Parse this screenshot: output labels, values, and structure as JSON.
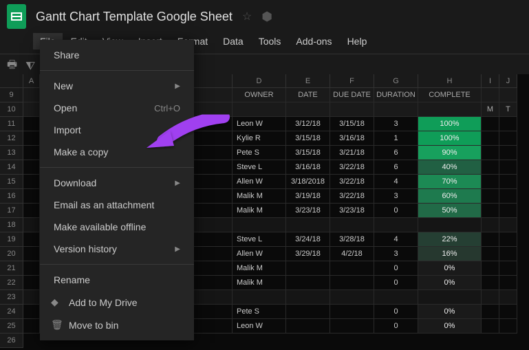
{
  "doc_title": "Gantt Chart Template Google Sheet",
  "menubar": [
    "File",
    "Edit",
    "View",
    "Insert",
    "Format",
    "Data",
    "Tools",
    "Add-ons",
    "Help"
  ],
  "dropdown": {
    "share": "Share",
    "new": "New",
    "open": "Open",
    "open_shortcut": "Ctrl+O",
    "import": "Import",
    "make_copy": "Make a copy",
    "download": "Download",
    "email_attach": "Email as an attachment",
    "offline": "Make available offline",
    "version": "Version history",
    "rename": "Rename",
    "add_drive": "Add to My Drive",
    "move_bin": "Move to bin"
  },
  "columns": {
    "A": "A",
    "D": "D",
    "E": "E",
    "F": "F",
    "G": "G",
    "H": "H",
    "I": "I",
    "J": "J",
    "owner": "OWNER",
    "date": "DATE",
    "due": "DUE DATE",
    "duration": "DURATION",
    "complete": "COMPLETE",
    "M": "M",
    "T": "T"
  },
  "row_nums": [
    "9",
    "10",
    "11",
    "12",
    "13",
    "14",
    "15",
    "16",
    "17",
    "18",
    "19",
    "20",
    "21",
    "22",
    "23",
    "24",
    "25",
    "26"
  ],
  "rows": [
    {
      "owner": "Leon W",
      "date": "3/12/18",
      "due": "3/15/18",
      "dur": "3",
      "comp": "100%",
      "bg": "#0f9d58"
    },
    {
      "owner": "Kylie R",
      "date": "3/15/18",
      "due": "3/16/18",
      "dur": "1",
      "comp": "100%",
      "bg": "#0f9d58"
    },
    {
      "owner": "Pete S",
      "date": "3/15/18",
      "due": "3/21/18",
      "dur": "6",
      "comp": "90%",
      "bg": "#17a05d"
    },
    {
      "owner": "Steve L",
      "date": "3/16/18",
      "due": "3/22/18",
      "dur": "6",
      "comp": "40%",
      "bg": "#216043"
    },
    {
      "owner": "Allen W",
      "date": "3/18/2018",
      "due": "3/22/18",
      "dur": "4",
      "comp": "70%",
      "bg": "#1c8a54"
    },
    {
      "owner": "Malik M",
      "date": "3/19/18",
      "due": "3/22/18",
      "dur": "3",
      "comp": "60%",
      "bg": "#1e7a4e"
    },
    {
      "owner": "Malik M",
      "date": "3/23/18",
      "due": "3/23/18",
      "dur": "0",
      "comp": "50%",
      "bg": "#216a47"
    }
  ],
  "rows2": [
    {
      "owner": "Steve L",
      "date": "3/24/18",
      "due": "3/28/18",
      "dur": "4",
      "comp": "22%",
      "bg": "#253f33"
    },
    {
      "owner": "Allen W",
      "date": "3/29/18",
      "due": "4/2/18",
      "dur": "3",
      "comp": "16%",
      "bg": "#26382f"
    },
    {
      "owner": "Malik M",
      "date": "",
      "due": "",
      "dur": "0",
      "comp": "0%",
      "bg": "#1a1a1a"
    },
    {
      "owner": "Malik M",
      "date": "",
      "due": "",
      "dur": "0",
      "comp": "0%",
      "bg": "#1a1a1a"
    }
  ],
  "rows3": [
    {
      "owner": "Pete S",
      "date": "",
      "due": "",
      "dur": "0",
      "comp": "0%",
      "bg": "#1a1a1a"
    },
    {
      "owner": "Leon W",
      "date": "",
      "due": "",
      "dur": "0",
      "comp": "0%",
      "bg": "#1a1a1a"
    }
  ]
}
